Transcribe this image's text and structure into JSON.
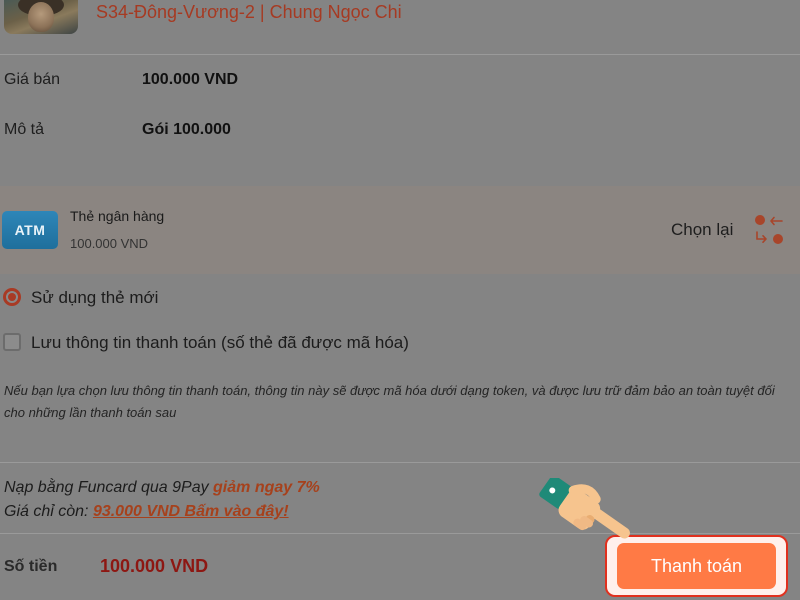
{
  "header": {
    "game_title": "S34-Đông-Vương-2 | Chung Ngọc Chi"
  },
  "details": {
    "price_label": "Giá bán",
    "price_value": "100.000 VND",
    "desc_label": "Mô tả",
    "desc_value": "Gói 100.000"
  },
  "payment_method": {
    "badge": "ATM",
    "name": "Thẻ ngân hàng",
    "amount": "100.000 VND",
    "reselect_label": "Chọn lại",
    "badge_color": "#2e86b8"
  },
  "options": {
    "use_new_card_label": "Sử dụng thẻ mới",
    "use_new_card_selected": true,
    "save_info_label": "Lưu thông tin thanh toán (số thẻ đã được mã hóa)",
    "save_info_checked": false,
    "note": "Nếu bạn lựa chọn lưu thông tin thanh toán, thông tin này sẽ được mã hóa dưới dạng token, và được lưu trữ đảm bảo an toàn tuyệt đối cho những lần thanh toán sau"
  },
  "promo": {
    "line1_prefix": "Nạp bằng Funcard qua 9Pay ",
    "line1_highlight": "giảm ngay 7%",
    "line2_prefix": "Giá chỉ còn: ",
    "line2_link": "93.000 VND Bấm vào đây!"
  },
  "footer": {
    "total_label": "Số tiền",
    "total_value": "100.000 VND",
    "pay_button": "Thanh toán"
  },
  "colors": {
    "accent": "#ff7a45",
    "title": "#a63a22",
    "total": "#8d1712",
    "highlight_border": "#e0301e"
  }
}
